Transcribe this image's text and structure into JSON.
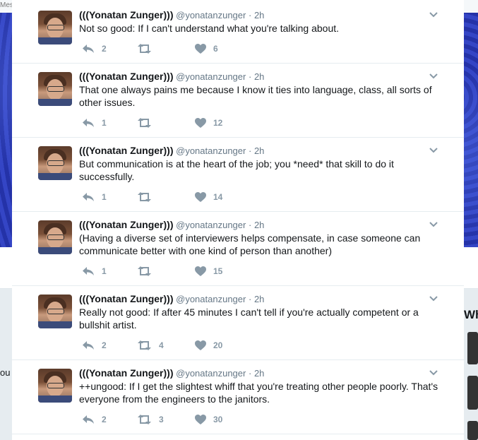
{
  "background": {
    "topbar_text": "Mes",
    "left_text": "ou",
    "right_text": "Wh"
  },
  "tweets": [
    {
      "name": "(((Yonatan Zunger)))",
      "handle": "@yonatanzunger",
      "dot": "·",
      "time": "2h",
      "text": "Not so good: If I can't understand what you're talking about.",
      "replies": "2",
      "retweets": "",
      "likes": "6"
    },
    {
      "name": "(((Yonatan Zunger)))",
      "handle": "@yonatanzunger",
      "dot": "·",
      "time": "2h",
      "text": "That one always pains me because I know it ties into language, class, all sorts of other issues.",
      "replies": "1",
      "retweets": "",
      "likes": "12"
    },
    {
      "name": "(((Yonatan Zunger)))",
      "handle": "@yonatanzunger",
      "dot": "·",
      "time": "2h",
      "text": "But communication is at the heart of the job; you *need* that skill to do it successfully.",
      "replies": "1",
      "retweets": "",
      "likes": "14"
    },
    {
      "name": "(((Yonatan Zunger)))",
      "handle": "@yonatanzunger",
      "dot": "·",
      "time": "2h",
      "text": "(Having a diverse set of interviewers helps compensate, in case someone can communicate better with one kind of person than another)",
      "replies": "1",
      "retweets": "",
      "likes": "15"
    },
    {
      "name": "(((Yonatan Zunger)))",
      "handle": "@yonatanzunger",
      "dot": "·",
      "time": "2h",
      "text": "Really not good: If after 45 minutes I can't tell if you're actually competent or a bullshit artist.",
      "replies": "2",
      "retweets": "4",
      "likes": "20"
    },
    {
      "name": "(((Yonatan Zunger)))",
      "handle": "@yonatanzunger",
      "dot": "·",
      "time": "2h",
      "text": "++ungood: If I get the slightest whiff that you're treating other people poorly. That's everyone from the engineers to the janitors.",
      "replies": "2",
      "retweets": "3",
      "likes": "30"
    }
  ],
  "icons": {
    "reply": "reply-icon",
    "retweet": "retweet-icon",
    "like": "heart-icon",
    "caret": "chevron-down-icon"
  },
  "colors": {
    "icon": "#8899a6",
    "text": "#14171a",
    "meta": "#657786",
    "banner": "#1e2a9e"
  }
}
